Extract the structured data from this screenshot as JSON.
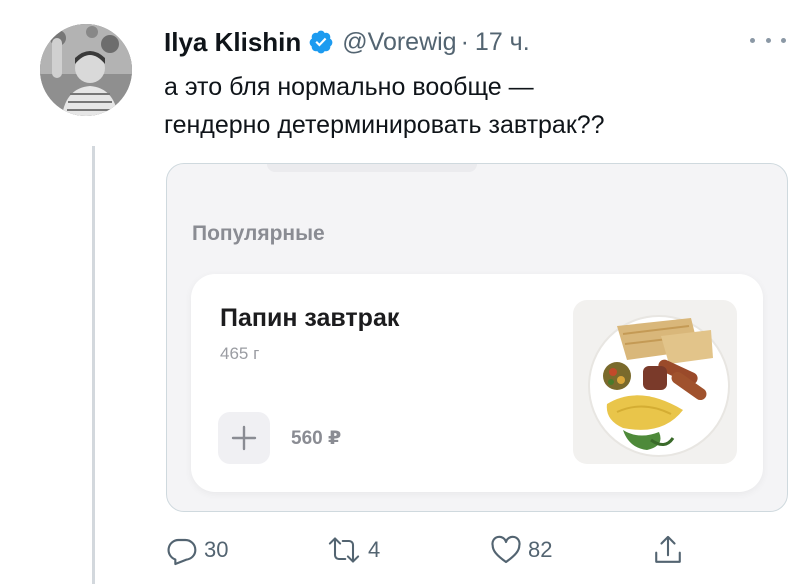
{
  "tweet": {
    "author_name": "Ilya Klishin",
    "handle": "@Vorewig",
    "separator": "·",
    "time": "17 ч.",
    "text_lines": [
      "а это бля нормально вообще —",
      "гендерно детерминировать завтрак??"
    ],
    "verified": true
  },
  "media": {
    "section_title": "Популярные",
    "dish": {
      "name": "Папин завтрак",
      "weight": "465 г",
      "price": "560 ₽",
      "add_icon": "plus-icon"
    }
  },
  "actions": {
    "reply_count": "30",
    "retweet_count": "4",
    "like_count": "82"
  },
  "colors": {
    "text": "#0f1419",
    "secondary": "#536471",
    "verified": "#1d9bf0",
    "border": "#cfd9de"
  }
}
